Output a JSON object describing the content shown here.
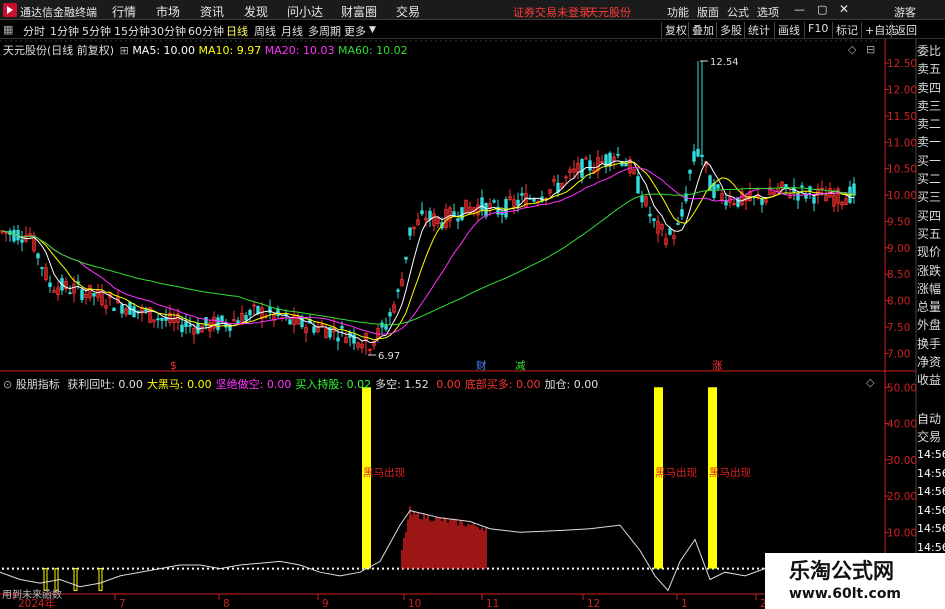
{
  "app": {
    "title": "通达信金融终端",
    "status_login": "证券交易未登录",
    "status_stock": "天元股份",
    "user": "游客"
  },
  "menu": [
    "行情",
    "市场",
    "资讯",
    "发现",
    "问小达",
    "财富圈",
    "交易"
  ],
  "menu_right": [
    "功能",
    "版面",
    "公式",
    "选项"
  ],
  "periods": [
    "分时",
    "1分钟",
    "5分钟",
    "15分钟",
    "30分钟",
    "60分钟",
    "日线",
    "周线",
    "月线",
    "多周期",
    "更多"
  ],
  "active_period": "日线",
  "toolbar_right": [
    "复权",
    "叠加",
    "多股",
    "统计",
    "画线",
    "F10",
    "标记",
    "+自选",
    "返回"
  ],
  "ma_legend": {
    "title": "天元股份(日线 前复权)",
    "ma5": "MA5: 10.00",
    "ma10": "MA10: 9.97",
    "ma20": "MA20: 10.03",
    "ma60": "MA60: 10.02"
  },
  "annotations": {
    "high": "12.54",
    "low": "6.97"
  },
  "event_markers": [
    "$",
    "财",
    "减",
    "涨"
  ],
  "indicator": {
    "name": "股朋指标",
    "items": [
      {
        "label": "获利回吐:",
        "value": "0.00",
        "color": "#e0e0e0"
      },
      {
        "label": "大黑马:",
        "value": "0.00",
        "color": "#ffff00"
      },
      {
        "label": "坚绝做空:",
        "value": "0.00",
        "color": "#ff33ff"
      },
      {
        "label": "买入持股:",
        "value": "0.02",
        "color": "#33ff33"
      },
      {
        "label": "多空:",
        "value": "1.52",
        "color": "#e0e0e0"
      },
      {
        "label": "",
        "value": "0.00",
        "color": "#ff3333"
      },
      {
        "label": "底部买多:",
        "value": "0.00",
        "color": "#ff3333"
      },
      {
        "label": "加仓:",
        "value": "0.00",
        "color": "#e0e0e0"
      }
    ]
  },
  "signal_label": "黑马出现",
  "future_label": "用到未来函数",
  "right_tabs": [
    "委比",
    "卖五",
    "卖四",
    "卖三",
    "卖二",
    "卖一",
    "买一",
    "买二",
    "买三",
    "买四",
    "买五",
    "现价",
    "涨跌",
    "涨幅",
    "总量",
    "外盘",
    "换手",
    "净资",
    "收益"
  ],
  "right_tabs2": [
    "自动",
    "交易",
    "14:56",
    "14:56",
    "14:56",
    "14:56",
    "14:56",
    "14:56",
    "14:56",
    "14:56"
  ],
  "watermark": {
    "title": "乐淘公式网",
    "url": "www.60lt.com"
  },
  "colors": {
    "up": "#ff3333",
    "down": "#33dddd",
    "ma5": "#ffffff",
    "ma10": "#ffff00",
    "ma20": "#ff33ff",
    "ma60": "#33dd33",
    "axis": "#cc2222"
  },
  "chart_data": [
    {
      "type": "candlestick",
      "x_axis": [
        "2024年",
        "7",
        "8",
        "9",
        "10",
        "11",
        "12",
        "1",
        "2"
      ],
      "y_axis": [
        "12.50",
        "12.00",
        "11.50",
        "11.00",
        "10.50",
        "10.00",
        "9.50",
        "9.00",
        "8.50",
        "8.00",
        "7.50",
        "7.00"
      ],
      "ylim": [
        6.9,
        12.7
      ]
    },
    {
      "type": "bar",
      "y_axis": [
        "50.00",
        "40.00",
        "30.00",
        "20.00",
        "10.00"
      ],
      "ylim": [
        -7,
        52
      ]
    }
  ]
}
